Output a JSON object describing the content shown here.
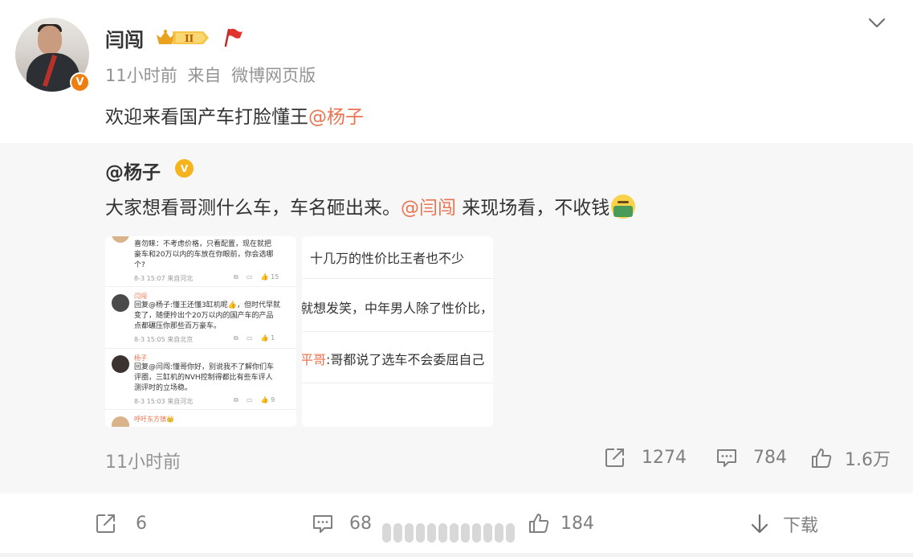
{
  "post": {
    "username": "闫闯",
    "meta_time": "11小时前",
    "meta_from": "来自",
    "meta_client": "微博网页版",
    "content_text": "欢迎来看国产车打脸懂王",
    "content_mention": "@杨子",
    "badge_text": "II"
  },
  "repost": {
    "username": "@杨子",
    "text_before": "大家想看哥测什么车，车名砸出来。",
    "mention": "@闫闯",
    "text_after": " 来现场看，不收钱",
    "time": "11小时前",
    "actions": {
      "share": "1274",
      "comment": "784",
      "like": "1.6万"
    },
    "image1": {
      "c1_l1": "喜勿睐：不考虑价格，只看配置，现在就把",
      "c1_l2": "豪车和20万以内的车放在你眼前，你会选哪",
      "c1_l3": "个?",
      "c1_time": "8-3 15:07 来自河北",
      "c1_likes": "15",
      "c2_name": "闫闯",
      "c2_l1": "回复@杨子:懂王还懂3缸机呢👍，但时代早就",
      "c2_l2": "变了，随便拎出个20万以内的国产车的产品",
      "c2_l3": "点都碾压你那些百万豪车。",
      "c2_time": "8-3 15:05 来自北京",
      "c2_likes": "1",
      "c3_name": "杨子",
      "c3_l1": "回复@闫闯:懂哥你好，别说我不了解你们车",
      "c3_l2": "评圈，三缸机的NVH控制得都比有些车评人",
      "c3_l3": "测评时的立场稳。",
      "c3_time": "8-3 15:03 来自河北",
      "c3_likes": "9",
      "c4_name": "呼吁东方镇👑"
    },
    "image2": {
      "line1": "，十几万的性价比王者也不少",
      "line2": "就想发笑，中年男人除了性价比，",
      "line3_name": "平哥",
      "line3_text": ":哥都说了选车不会委屈自己"
    }
  },
  "bottom": {
    "share": "6",
    "comment": "68",
    "like": "184",
    "download": "下载"
  },
  "colors": {
    "mention": "#eb7350",
    "meta": "#939393",
    "vip": "#f07d10"
  }
}
